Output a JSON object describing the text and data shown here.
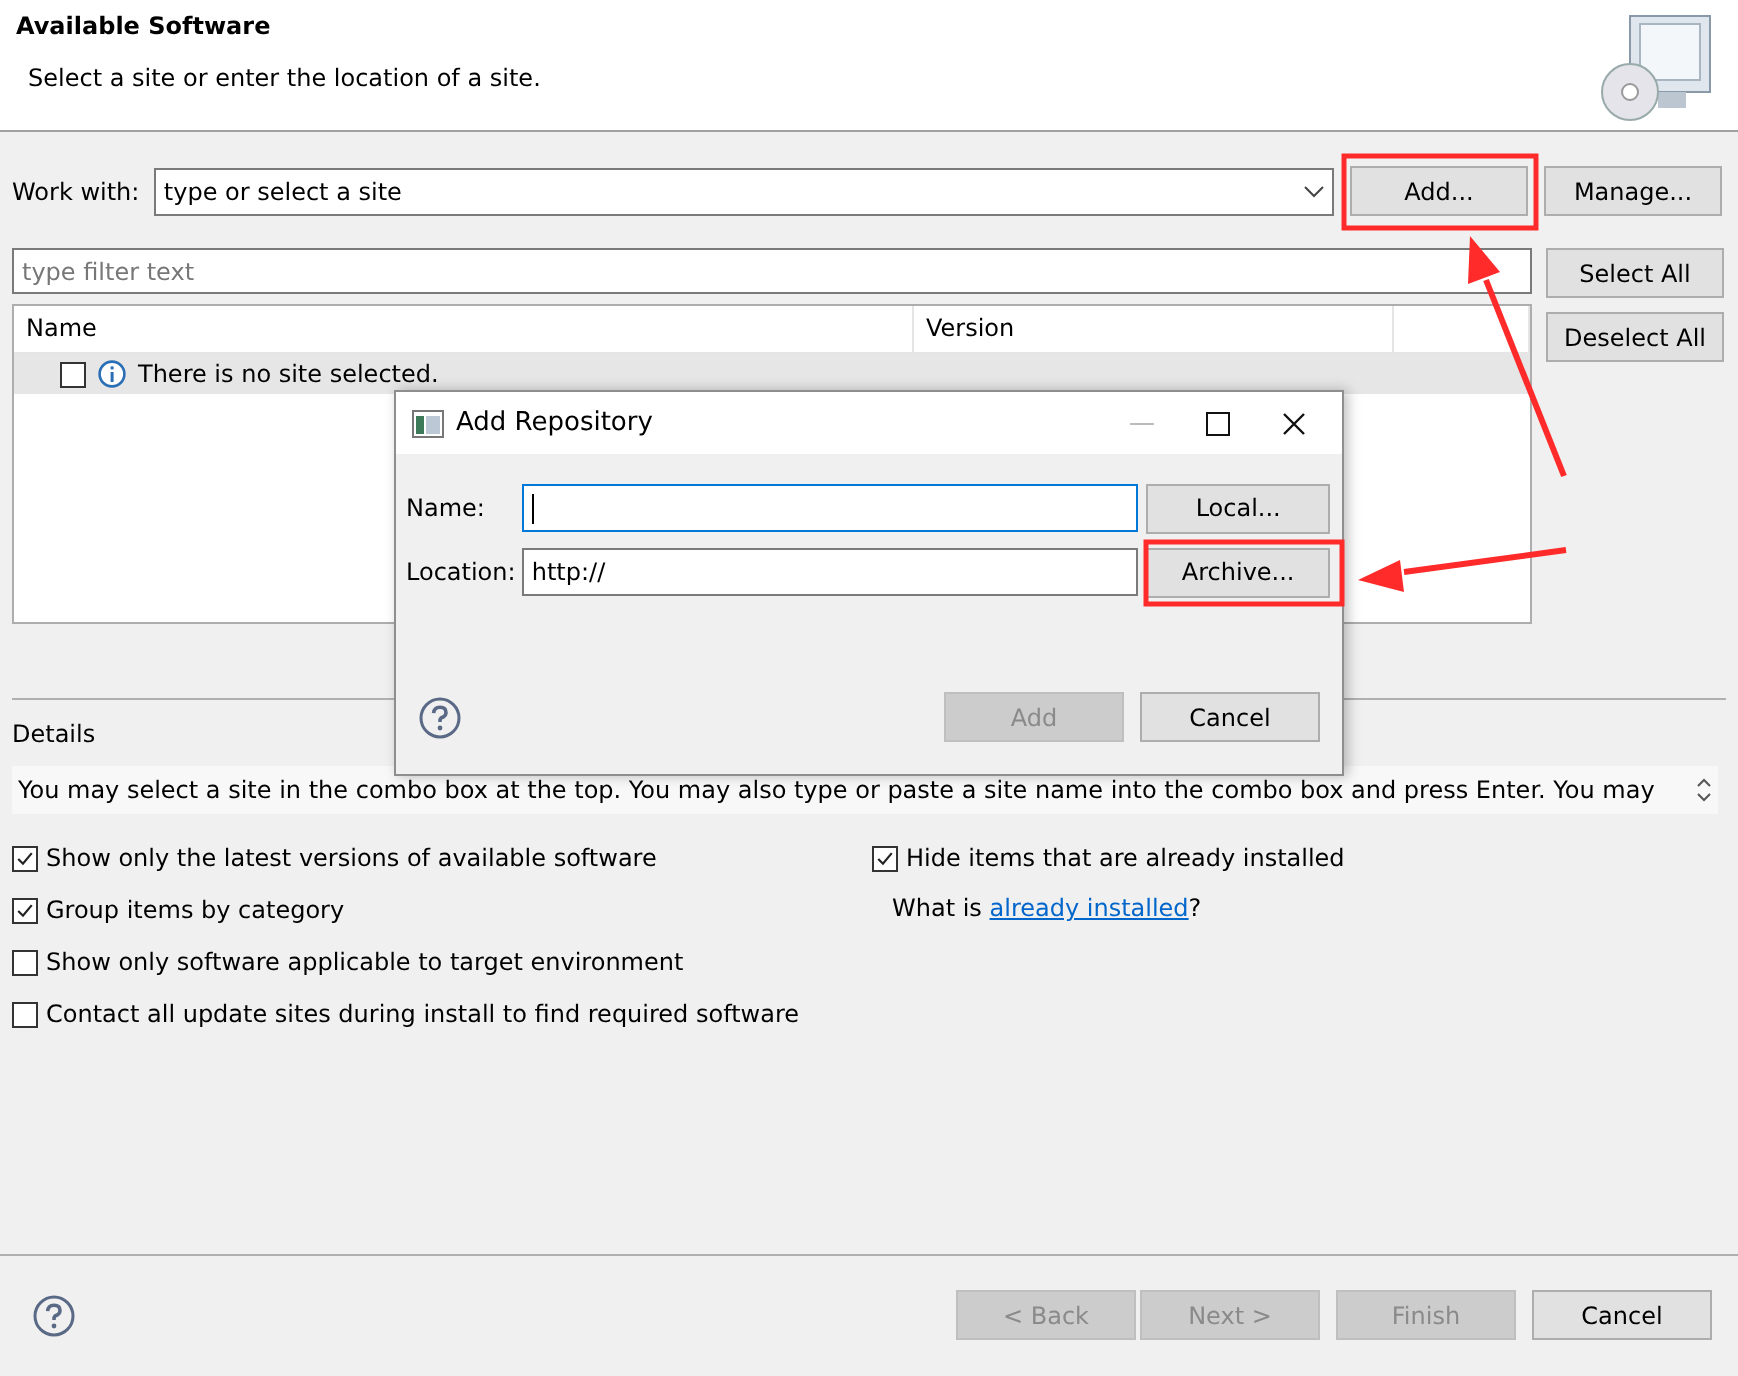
{
  "header": {
    "title": "Available Software",
    "subtitle": "Select a site or enter the location of a site."
  },
  "work_with": {
    "label": "Work with:",
    "value": "type or select a site",
    "buttons": [
      {
        "label": "Add...",
        "disabled": false
      },
      {
        "label": "Manage...",
        "disabled": false
      }
    ]
  },
  "filter": {
    "placeholder": "type filter text"
  },
  "side_buttons": [
    {
      "label": "Select All",
      "disabled": false
    },
    {
      "label": "Deselect All",
      "disabled": false
    }
  ],
  "table": {
    "columns": [
      "Name",
      "Version"
    ],
    "rows": [
      {
        "text": "There is no site selected.",
        "checked": false,
        "selected": true
      }
    ]
  },
  "details": {
    "label": "Details",
    "text": "You may select a site in the combo box at the top.  You may also type or paste a site name into the combo box and press Enter.  You may"
  },
  "options_left": [
    {
      "label": "Show only the latest versions of available software",
      "checked": true
    },
    {
      "label": "Group items by category",
      "checked": true
    },
    {
      "label": "Show only software applicable to target environment",
      "checked": false
    },
    {
      "label": "Contact all update sites during install to find required software",
      "checked": false
    }
  ],
  "options_right": {
    "checkbox": {
      "label": "Hide items that are already installed",
      "checked": true
    },
    "note_prefix": "What is ",
    "link": "already installed",
    "note_suffix": "?"
  },
  "footer_buttons": [
    {
      "label": "< Back",
      "disabled": true
    },
    {
      "label": "Next >",
      "disabled": true
    },
    {
      "label": "Finish",
      "disabled": true
    },
    {
      "label": "Cancel",
      "disabled": false
    }
  ],
  "dialog": {
    "title": "Add Repository",
    "fields": [
      {
        "label": "Name:",
        "button": {
          "label": "Local...",
          "disabled": false
        }
      },
      {
        "label": "Location:",
        "value": "http://",
        "button": {
          "label": "Archive...",
          "disabled": false
        }
      }
    ],
    "buttons": [
      {
        "label": "Add",
        "disabled": true
      },
      {
        "label": "Cancel",
        "disabled": false
      }
    ]
  }
}
